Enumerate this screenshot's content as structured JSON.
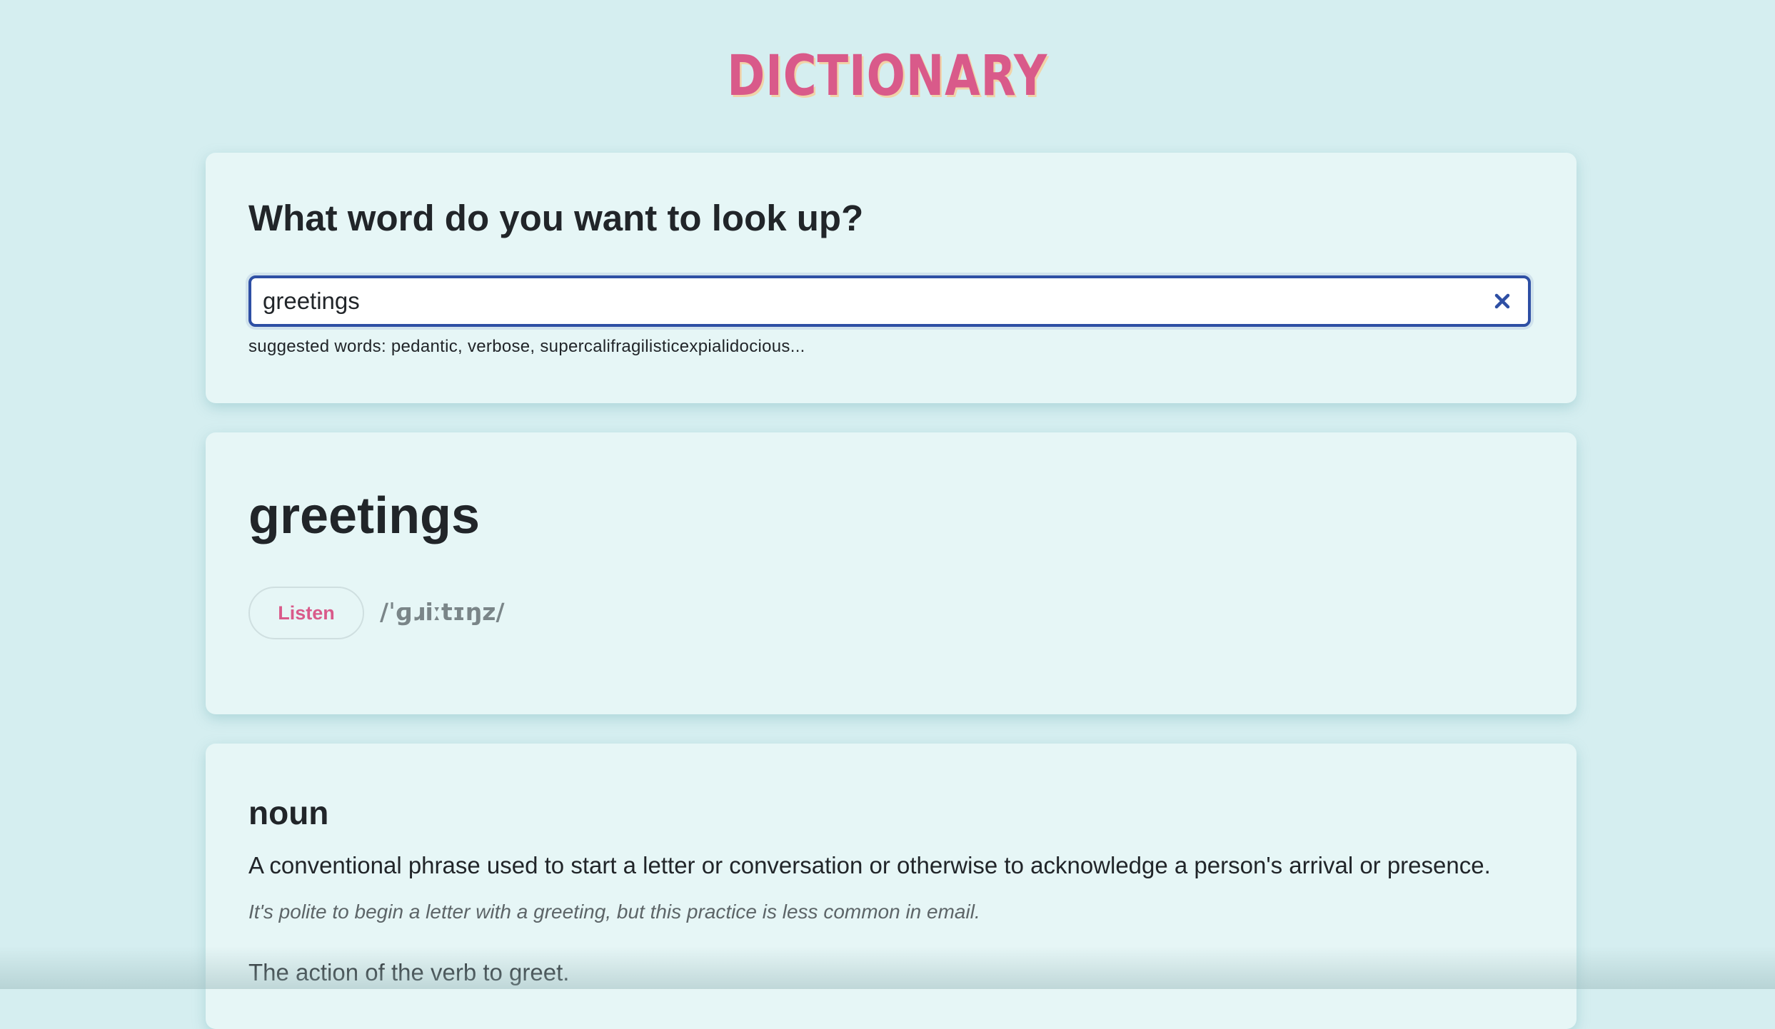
{
  "header": {
    "logo_text": "DICTIONARY"
  },
  "search": {
    "heading": "What word do you want to look up?",
    "value": "greetings",
    "clear_icon": "close-icon",
    "suggestions": "suggested words: pedantic, verbose, supercalifragilisticexpialidocious..."
  },
  "word": {
    "title": "greetings",
    "listen_label": "Listen",
    "phonetic": "/ˈɡɹiːtɪŋz/"
  },
  "meaning": {
    "part_of_speech": "noun",
    "definitions": [
      {
        "text": "A conventional phrase used to start a letter or conversation or otherwise to acknowledge a person's arrival or presence.",
        "example": "It's polite to begin a letter with a greeting, but this practice is less common in email."
      },
      {
        "text": "The action of the verb to greet."
      }
    ]
  },
  "colors": {
    "background": "#d5eef0",
    "card": "#e6f6f6",
    "accent": "#d95a8a",
    "input_border": "#2e4fa4"
  }
}
